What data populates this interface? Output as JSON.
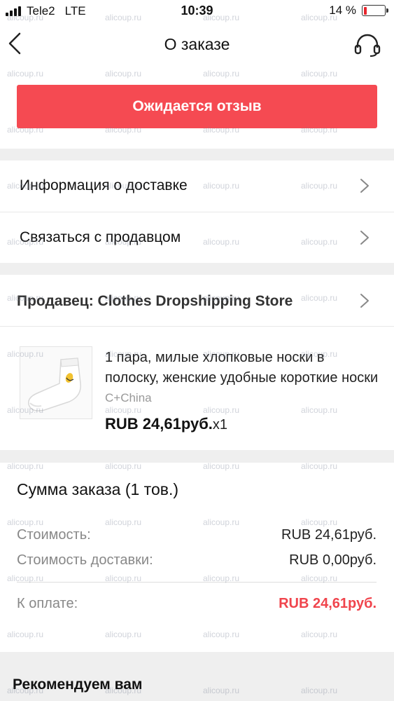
{
  "status_bar": {
    "carrier": "Tele2",
    "network": "LTE",
    "time": "10:39",
    "battery": "14 %",
    "battery_level": 0.14
  },
  "nav": {
    "title": "О заказе",
    "back_icon": "chevron-left-icon",
    "support_icon": "headset-icon"
  },
  "order_status": {
    "label": "Ожидается отзыв",
    "color": "#f54a52"
  },
  "links": [
    {
      "label": "Информация о доставке"
    },
    {
      "label": "Связаться с продавцом"
    }
  ],
  "seller": {
    "label": "Продавец: Clothes Dropshipping Store"
  },
  "product": {
    "name": "1 пара, милые хлопковые носки в полоску, женские удобные короткие носки",
    "variant": "C+China",
    "price": "RUB 24,61руб.",
    "quantity": "x1"
  },
  "summary": {
    "title": "Сумма заказа (1 тов.)",
    "rows": [
      {
        "label": "Стоимость:",
        "value": "RUB 24,61руб."
      },
      {
        "label": "Стоимость доставки:",
        "value": "RUB 0,00руб."
      }
    ],
    "total": {
      "label": "К оплате:",
      "value": "RUB 24,61руб."
    },
    "accent_color": "#f0444c"
  },
  "recommendations": {
    "title": "Рекомендуем вам"
  },
  "watermark": "alicoup.ru"
}
